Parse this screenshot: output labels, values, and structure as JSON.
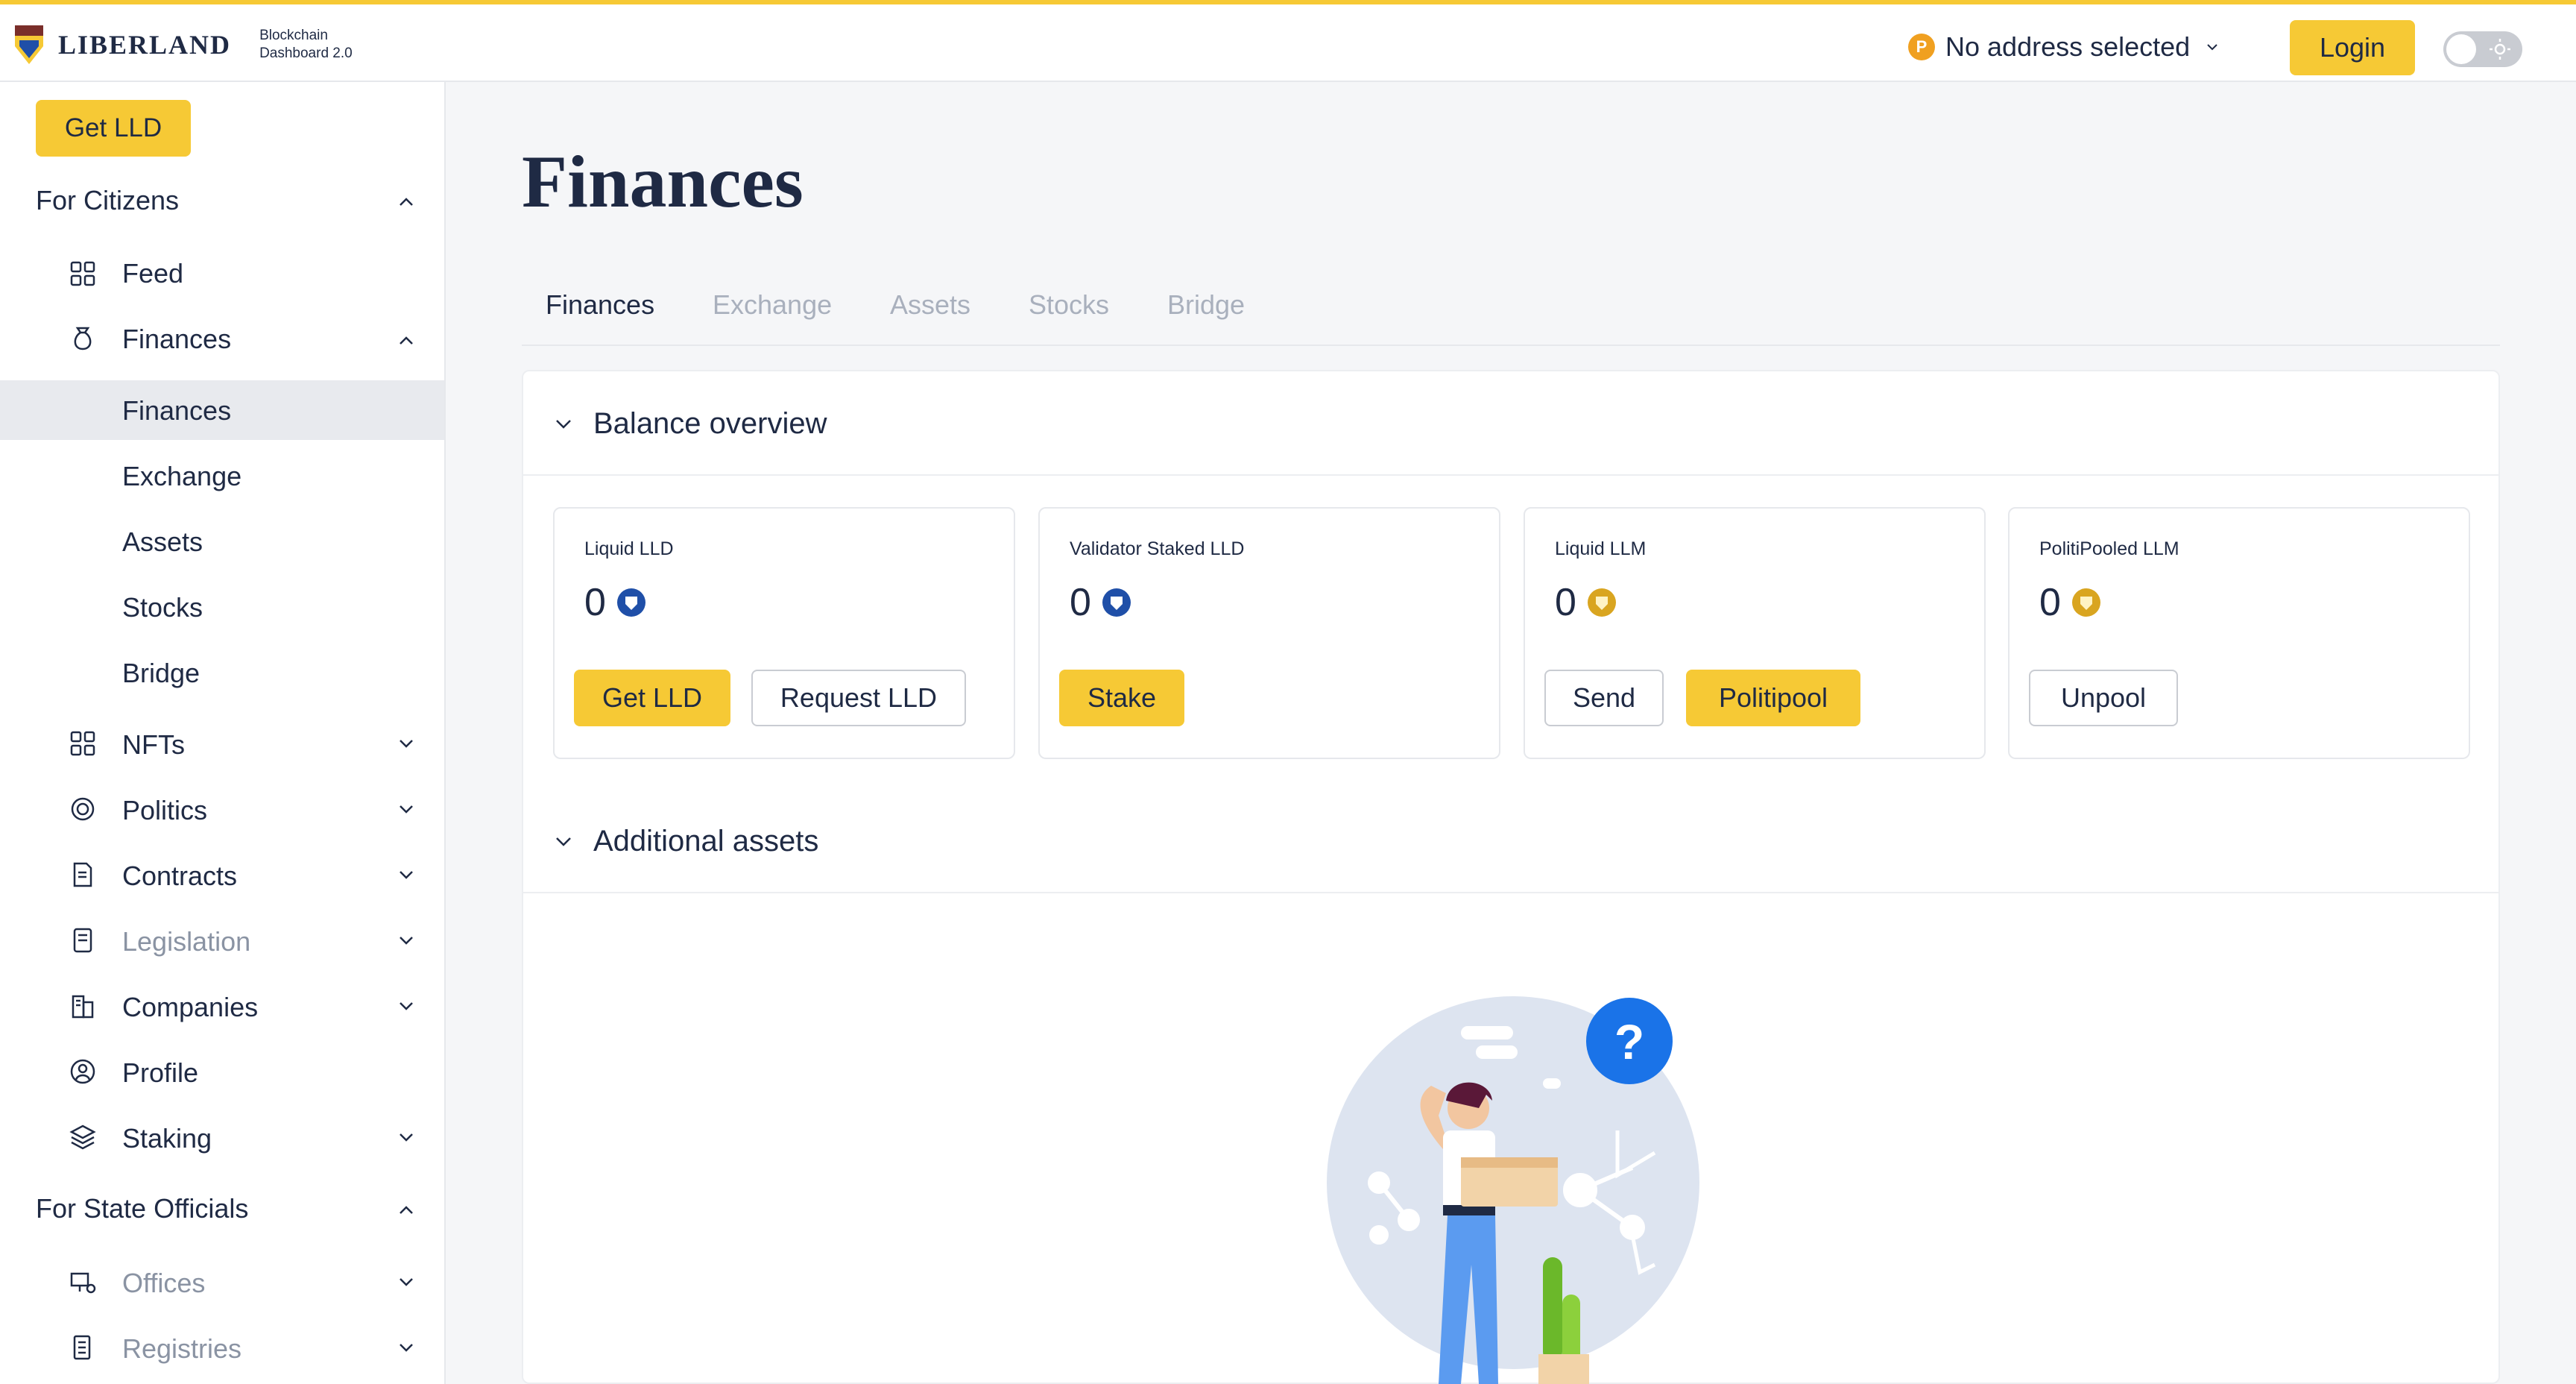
{
  "header": {
    "logo_text": "LIBERLAND",
    "logo_sub_line1": "Blockchain",
    "logo_sub_line2": "Dashboard 2.0",
    "address_icon": "P",
    "address_label": "No address selected",
    "login_label": "Login"
  },
  "sidebar": {
    "get_lld_label": "Get LLD",
    "section_citizens": "For Citizens",
    "feed": "Feed",
    "finances": "Finances",
    "finances_sub": [
      "Finances",
      "Exchange",
      "Assets",
      "Stocks",
      "Bridge"
    ],
    "nfts": "NFTs",
    "politics": "Politics",
    "contracts": "Contracts",
    "legislation": "Legislation",
    "companies": "Companies",
    "profile": "Profile",
    "staking": "Staking",
    "section_officials": "For State Officials",
    "offices": "Offices",
    "registries": "Registries"
  },
  "main": {
    "title": "Finances",
    "tabs": [
      "Finances",
      "Exchange",
      "Assets",
      "Stocks",
      "Bridge"
    ],
    "balance_overview": "Balance overview",
    "additional_assets": "Additional assets",
    "cards": [
      {
        "label": "Liquid LLD",
        "value": "0",
        "buttons": [
          "Get LLD",
          "Request LLD"
        ]
      },
      {
        "label": "Validator Staked LLD",
        "value": "0",
        "buttons": [
          "Stake"
        ]
      },
      {
        "label": "Liquid LLM",
        "value": "0",
        "buttons": [
          "Send",
          "Politipool"
        ]
      },
      {
        "label": "PolitiPooled LLM",
        "value": "0",
        "buttons": [
          "Unpool"
        ]
      }
    ]
  },
  "colors": {
    "accent": "#f6c935",
    "text": "#1f2a44",
    "muted": "#a9b0bd",
    "lld_coin": "#1f4fa8",
    "llm_coin": "#d9a520"
  }
}
